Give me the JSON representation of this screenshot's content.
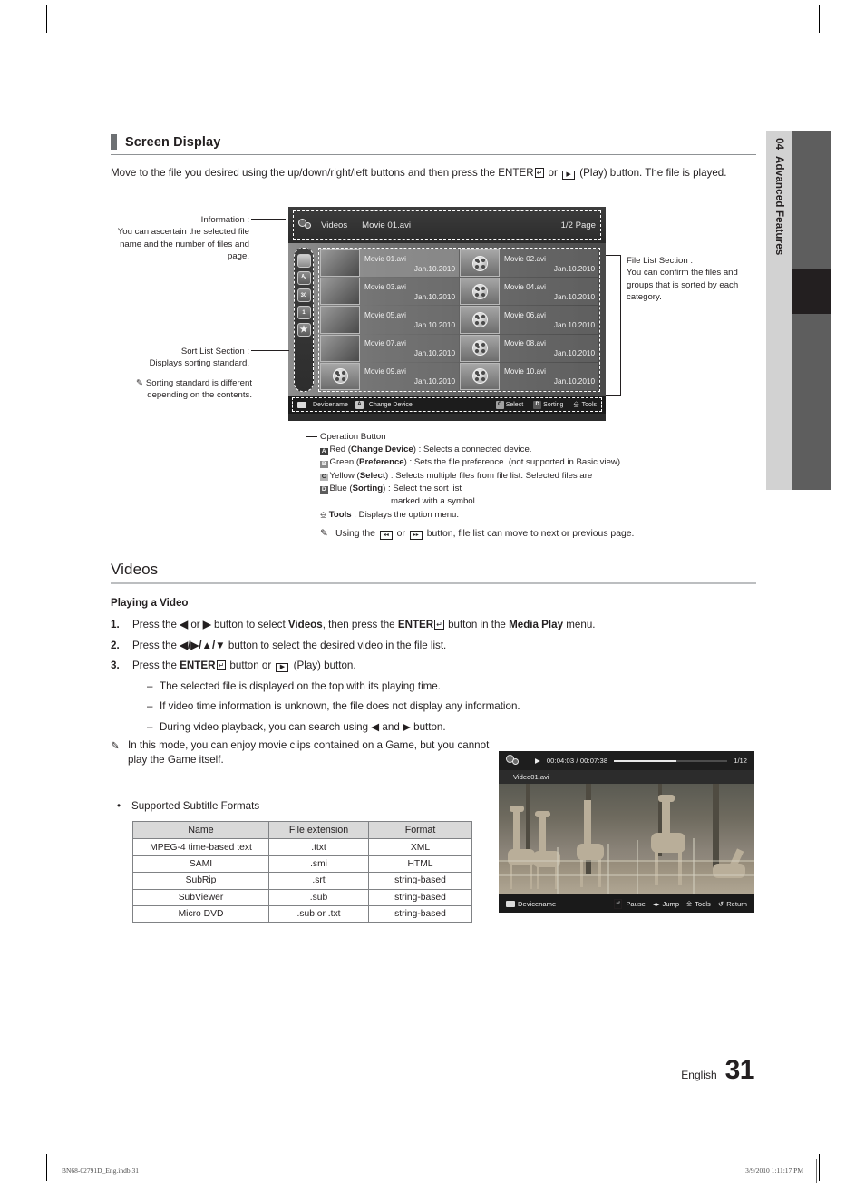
{
  "chapter": {
    "number": "04",
    "title": "Advanced Features"
  },
  "section": {
    "heading": "Screen Display"
  },
  "intro": {
    "part1": "Move to the file you desired using the up/down/right/left buttons and then press the ENTER",
    "enter_glyph": "↵",
    "part2": " or ",
    "play_glyph": "▶",
    "part3": " (Play) button. The file is played."
  },
  "callouts": {
    "information": {
      "title": "Information :",
      "body": "You can ascertain the selected file name and the number of files and page."
    },
    "sort_list": {
      "title": "Sort List Section :",
      "body": "Displays sorting standard.",
      "note": "Sorting standard is different depending on the contents."
    },
    "file_list": {
      "title": "File List Section :",
      "body": "You can confirm the files and groups that is sorted by each category."
    },
    "operation": {
      "title": "Operation Button",
      "rows": [
        {
          "key": "A",
          "color_word": "Red",
          "label": "Change Device",
          "desc": " : Selects a connected device."
        },
        {
          "key": "B",
          "color_word": "Green",
          "label": "Preference",
          "desc": " : Sets the file preference. (not supported in Basic view)"
        },
        {
          "key": "C",
          "color_word": "Yellow",
          "label": "Select",
          "desc": " : Selects multiple files from file list. Selected files are"
        },
        {
          "key": "D",
          "color_word": "Blue",
          "label": "Sorting",
          "desc": "  : Select the sort list"
        }
      ],
      "row3_cont": "marked with a symbol",
      "tools_label": "Tools",
      "tools_desc": " : Displays the option menu.",
      "note_part1": "Using the ",
      "note_rew": "◂◂",
      "note_part2": " or ",
      "note_ff": "▸▸",
      "note_part3": " button, file list can move to next or previous page."
    }
  },
  "tv_screen": {
    "category": "Videos",
    "current_file": "Movie 01.avi",
    "page_indicator": "1/2 Page",
    "sort_icons": [
      "folder-icon",
      "a-z-sort-icon",
      "month-30-icon",
      "day-1-icon",
      "favorites-star-icon"
    ],
    "files": [
      {
        "name": "Movie 01.avi",
        "date": "Jan.10.2010",
        "thumb": "photo",
        "selected": true
      },
      {
        "name": "Movie 02.avi",
        "date": "Jan.10.2010",
        "thumb": "reel",
        "selected": false
      },
      {
        "name": "Movie 03.avi",
        "date": "Jan.10.2010",
        "thumb": "photo",
        "selected": false
      },
      {
        "name": "Movie 04.avi",
        "date": "Jan.10.2010",
        "thumb": "reel",
        "selected": false
      },
      {
        "name": "Movie 05.avi",
        "date": "Jan.10.2010",
        "thumb": "photo",
        "selected": false
      },
      {
        "name": "Movie 06.avi",
        "date": "Jan.10.2010",
        "thumb": "reel",
        "selected": false
      },
      {
        "name": "Movie 07.avi",
        "date": "Jan.10.2010",
        "thumb": "photo",
        "selected": false
      },
      {
        "name": "Movie 08.avi",
        "date": "Jan.10.2010",
        "thumb": "reel",
        "selected": false
      },
      {
        "name": "Movie 09.avi",
        "date": "Jan.10.2010",
        "thumb": "reel",
        "selected": false
      },
      {
        "name": "Movie 10.avi",
        "date": "Jan.10.2010",
        "thumb": "reel",
        "selected": false
      }
    ],
    "footer": {
      "device_label": "Devicename",
      "change_device_key": "A",
      "change_device_label": "Change Device",
      "select_key": "C",
      "select_label": "Select",
      "sorting_key": "D",
      "sorting_label": "Sorting",
      "tools_label": "Tools"
    }
  },
  "videos": {
    "heading": "Videos",
    "subheading": "Playing a Video",
    "steps": [
      {
        "num": "1.",
        "t1": "Press the ",
        "left": "◀",
        "t2": " or ",
        "right": "▶",
        "t3": " button to select ",
        "bold1": "Videos",
        "t4": ", then press the ",
        "enter": "ENTER",
        "t5": " button in the ",
        "bold2": "Media Play",
        "t6": " menu."
      },
      {
        "num": "2.",
        "t1": "Press the ",
        "keys": "◀/▶/▲/▼",
        "t2": " button to select the desired video in the file list."
      },
      {
        "num": "3.",
        "t1": "Press the ",
        "enter": "ENTER",
        "t2": " button or ",
        "play": "▶",
        "t3": " (Play) button."
      }
    ],
    "dashes": [
      "The selected file is displayed on the top with its playing time.",
      "If video time information is unknown, the file does not display any information.",
      "During video playback, you can search using ◀ and ▶ button."
    ],
    "note": "In this mode, you can enjoy movie clips contained on a Game, but you cannot play the Game itself.",
    "bullet": "Supported Subtitle Formats"
  },
  "subtitle_table": {
    "headers": [
      "Name",
      "File extension",
      "Format"
    ],
    "rows": [
      [
        "MPEG-4 time-based text",
        ".ttxt",
        "XML"
      ],
      [
        "SAMI",
        ".smi",
        "HTML"
      ],
      [
        "SubRip",
        ".srt",
        "string-based"
      ],
      [
        "SubViewer",
        ".sub",
        "string-based"
      ],
      [
        "Micro DVD",
        ".sub or .txt",
        "string-based"
      ]
    ]
  },
  "playback_screen": {
    "play_glyph": "▶",
    "time": "00:04:03 / 00:07:38",
    "index": "1/12",
    "file_name": "Video01.avi",
    "device_label": "Devicename",
    "pause_label": "Pause",
    "jump_label": "Jump",
    "tools_label": "Tools",
    "return_label": "Return",
    "jump_glyph": "◂▸",
    "return_glyph": "↺"
  },
  "page_footer": {
    "language": "English",
    "page_number": "31"
  },
  "print_footer": {
    "file": "BN68-02791D_Eng.indb   31",
    "timestamp": "3/9/2010   1:11:17 PM"
  }
}
